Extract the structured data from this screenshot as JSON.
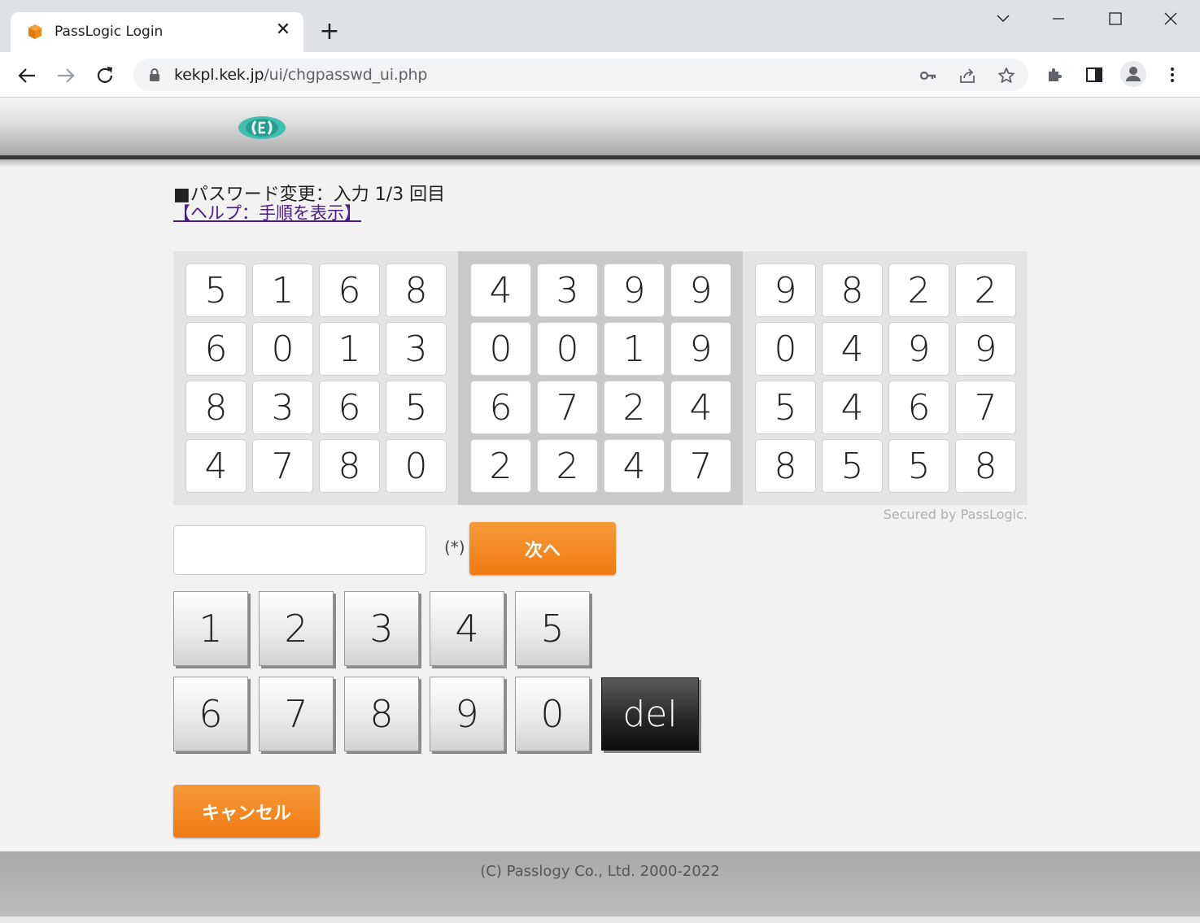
{
  "browser": {
    "tab_title": "PassLogic Login",
    "tab_close": "✕",
    "new_tab": "+",
    "url_host": "kekpl.kek.jp",
    "url_path": "/ui/chgpasswd_ui.php"
  },
  "page": {
    "title": "■パスワード変更：入力 1/3 回目",
    "help_link": "【ヘルプ：手順を表示】",
    "matrix": [
      [
        "5",
        "1",
        "6",
        "8",
        "6",
        "0",
        "1",
        "3",
        "8",
        "3",
        "6",
        "5",
        "4",
        "7",
        "8",
        "0"
      ],
      [
        "4",
        "3",
        "9",
        "9",
        "0",
        "0",
        "1",
        "9",
        "6",
        "7",
        "2",
        "4",
        "2",
        "2",
        "4",
        "7"
      ],
      [
        "9",
        "8",
        "2",
        "2",
        "0",
        "4",
        "9",
        "9",
        "5",
        "4",
        "6",
        "7",
        "8",
        "5",
        "5",
        "8"
      ]
    ],
    "secured_by": "Secured by PassLogic.",
    "password_placeholder": "",
    "asterisk": "(*)",
    "next_button": "次へ",
    "keypad_row1": [
      "1",
      "2",
      "3",
      "4",
      "5"
    ],
    "keypad_row2": [
      "6",
      "7",
      "8",
      "9",
      "0"
    ],
    "del_button": "del",
    "cancel_button": "キャンセル",
    "footer": "(C) Passlogy Co., Ltd. 2000-2022"
  },
  "colors": {
    "accent_orange": "#f07a12",
    "link_purple": "#4b1a8b"
  }
}
